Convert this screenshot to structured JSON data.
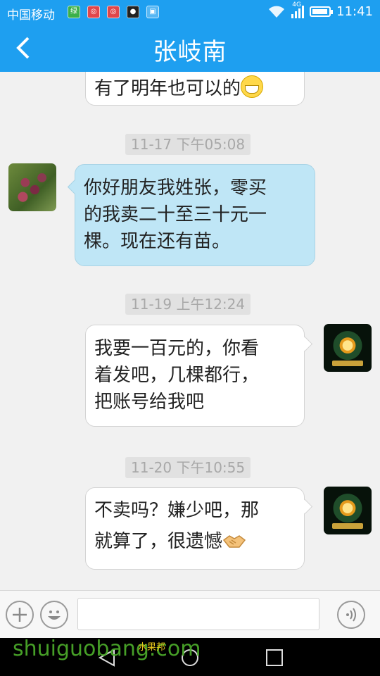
{
  "status_bar": {
    "carrier": "中国移动",
    "network": "4G",
    "time": "11:41",
    "battery_percent": 95
  },
  "header": {
    "title": "张岐南",
    "color": "#1e9ff0"
  },
  "messages": [
    {
      "type": "out",
      "text": "有了明年也可以的",
      "emoji": "grin-icon"
    },
    {
      "type": "time",
      "text": "11-17 下午05:08"
    },
    {
      "type": "in",
      "text_lines": [
        "你好朋友我姓张，零买",
        "的我卖二十至三十元一",
        "棵。现在还有苗。"
      ]
    },
    {
      "type": "time",
      "text": "11-19 上午12:24"
    },
    {
      "type": "out",
      "text_lines": [
        "我要一百元的，你看",
        "着发吧，几棵都行，",
        "把账号给我吧"
      ]
    },
    {
      "type": "time",
      "text": "11-20 下午10:55"
    },
    {
      "type": "out",
      "text_lines": [
        "不卖吗？嫌少吧，那",
        "就算了，很遗憾"
      ],
      "emoji": "handshake-icon"
    }
  ],
  "input": {
    "placeholder": ""
  },
  "watermark": {
    "text": "shuiguobang.com",
    "sub": "水果邦"
  }
}
